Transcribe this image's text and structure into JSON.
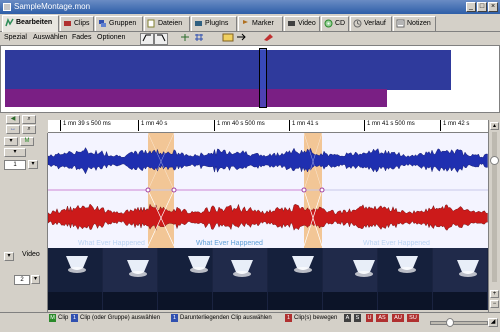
{
  "window": {
    "title": "SampleMontage.mon"
  },
  "tabs": [
    {
      "label": "Bearbeiten",
      "icon": "edit-icon",
      "color": "#2e8b57"
    },
    {
      "label": "Clips",
      "icon": "clips-icon",
      "color": "#b03030"
    },
    {
      "label": "Gruppen",
      "icon": "groups-icon",
      "color": "#3050b0"
    },
    {
      "label": "Dateien",
      "icon": "files-icon",
      "color": "#808030"
    },
    {
      "label": "PlugIns",
      "icon": "plugins-icon",
      "color": "#306080"
    },
    {
      "label": "Marker",
      "icon": "marker-icon",
      "color": "#b07020"
    },
    {
      "label": "Video",
      "icon": "video-icon",
      "color": "#404040"
    },
    {
      "label": "CD",
      "icon": "cd-icon",
      "color": "#2a8a2a"
    },
    {
      "label": "Verlauf",
      "icon": "history-icon",
      "color": "#6a6a6a"
    },
    {
      "label": "Notizen",
      "icon": "notes-icon",
      "color": "#6a6a6a"
    }
  ],
  "menu": [
    "Spezial",
    "Auswählen",
    "Fades",
    "Optionen"
  ],
  "side": {
    "zoom_value": "1",
    "channel_value": "2",
    "video_label": "Video"
  },
  "ruler": [
    "1 mn 39 s 500 ms",
    "1 mn 40 s",
    "1 mn 40 s 500 ms",
    "1 mn 41 s",
    "1 mn 41 s 500 ms",
    "1 mn 42 s"
  ],
  "clips": {
    "center_label": "What Ever Happened",
    "left_label": "What Ever Happened",
    "right_label": "What Ever Happened"
  },
  "status": {
    "segments": [
      {
        "key": "M",
        "key_color": "#2a8a2a",
        "text": "Clip"
      },
      {
        "key": "1",
        "key_color": "#3050b0",
        "text": "Clip (oder Gruppe) auswählen"
      },
      {
        "key": "1",
        "key_color": "#3050b0",
        "text": "Darunterliegenden Clip auswählen"
      },
      {
        "key": "1",
        "key_color": "#b03030",
        "text": "Clip(s) bewegen"
      }
    ],
    "mod_keys": [
      "A",
      "S",
      "U",
      "AS",
      "AU",
      "SU"
    ]
  },
  "colors": {
    "overview_top": "#2f3a9c",
    "overview_bottom": "#7a1f84",
    "wave_top": "#1f2fb0",
    "wave_bottom": "#cc1a1a",
    "crossfade": "#f0a040"
  }
}
